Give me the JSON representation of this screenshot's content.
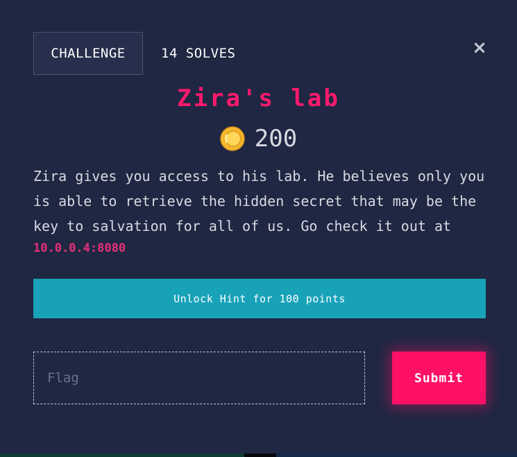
{
  "header": {
    "tab_label": "CHALLENGE",
    "solves_label": "14 SOLVES",
    "close_symbol": "×"
  },
  "challenge": {
    "title": "Zira's lab",
    "points": "200",
    "description": "Zira gives you access to his lab. He believes only you is able to retrieve the hidden secret that may be the key to salvation for all of us. Go check it out at",
    "address": "10.0.0.4:8080"
  },
  "hint": {
    "button_label": "Unlock Hint for 100 points"
  },
  "flag_form": {
    "placeholder": "Flag",
    "value": "",
    "submit_label": "Submit"
  },
  "icons": {
    "coin": "coin-icon",
    "close": "close-icon"
  },
  "colors": {
    "background": "#1f2742",
    "accent_pink": "#ff1067",
    "hint_teal": "#17a2b8",
    "coin_gold": "#f5b82e"
  }
}
